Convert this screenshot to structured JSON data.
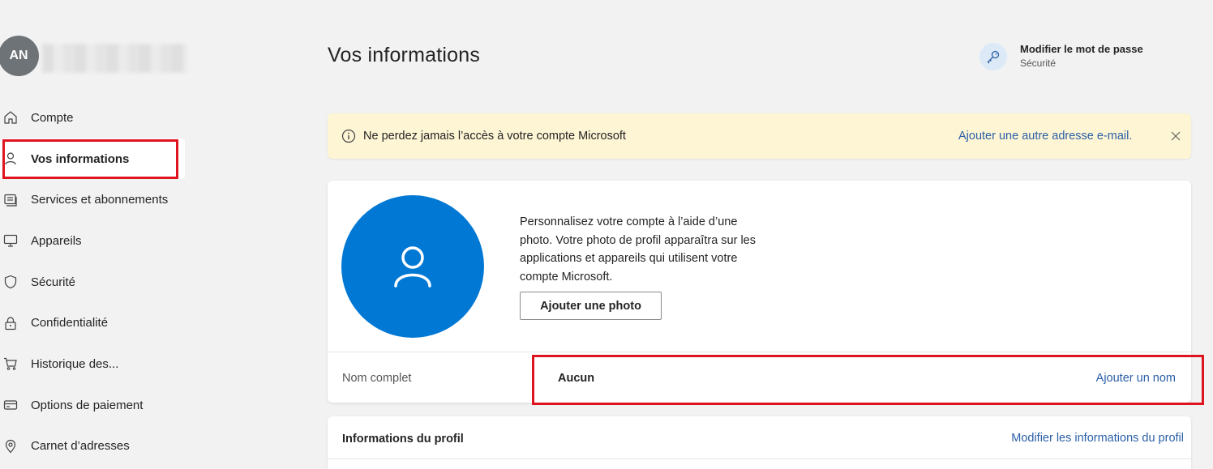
{
  "user": {
    "initials": "AN"
  },
  "nav": {
    "items": [
      {
        "label": "Compte",
        "icon": "home-icon"
      },
      {
        "label": "Vos informations",
        "icon": "person-icon",
        "active": true
      },
      {
        "label": "Services et abonnements",
        "icon": "subscriptions-icon"
      },
      {
        "label": "Appareils",
        "icon": "monitor-icon"
      },
      {
        "label": "Sécurité",
        "icon": "shield-icon"
      },
      {
        "label": "Confidentialité",
        "icon": "lock-icon"
      },
      {
        "label": "Historique des...",
        "icon": "cart-icon"
      },
      {
        "label": "Options de paiement",
        "icon": "card-icon"
      },
      {
        "label": "Carnet d’adresses",
        "icon": "location-icon"
      }
    ]
  },
  "header": {
    "title": "Vos informations",
    "password_link": {
      "title": "Modifier le mot de passe",
      "subtitle": "Sécurité"
    }
  },
  "banner": {
    "message": "Ne perdez jamais l’accès à votre compte Microsoft",
    "link": "Ajouter une autre adresse e-mail."
  },
  "profile_card": {
    "description": "Personnalisez votre compte à l’aide d’une photo. Votre photo de profil apparaîtra sur les applications et appareils qui utilisent votre compte Microsoft.",
    "add_photo_button": "Ajouter une photo",
    "full_name_label": "Nom complet",
    "full_name_value": "Aucun",
    "add_name_link": "Ajouter un nom"
  },
  "profile_info": {
    "title": "Informations du profil",
    "edit_link": "Modifier les informations du profil"
  },
  "colors": {
    "accent": "#0078d4",
    "link": "#2b5fa6",
    "banner_bg": "#fdf5d4",
    "highlight_box": "#e0141e",
    "page_bg": "#f2f2f2"
  }
}
